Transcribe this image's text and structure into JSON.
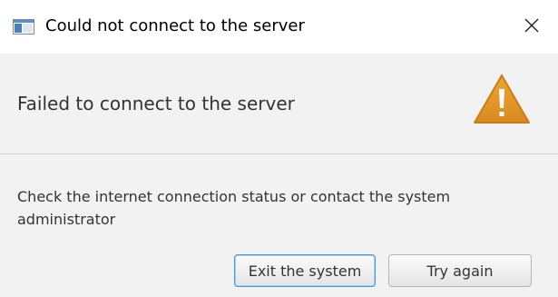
{
  "window": {
    "title": "Could not connect to the server",
    "close_icon": "close-icon",
    "app_icon": "window-icon"
  },
  "header": {
    "message": "Failed to connect to the server",
    "icon": "warning-icon",
    "icon_color": "#e0962a"
  },
  "content": {
    "text": "Check the internet connection status or contact the system administrator"
  },
  "buttons": {
    "exit_label": "Exit the system",
    "retry_label": "Try again"
  },
  "colors": {
    "focus_border": "#3a9bd8",
    "background": "#f2f2f2"
  }
}
